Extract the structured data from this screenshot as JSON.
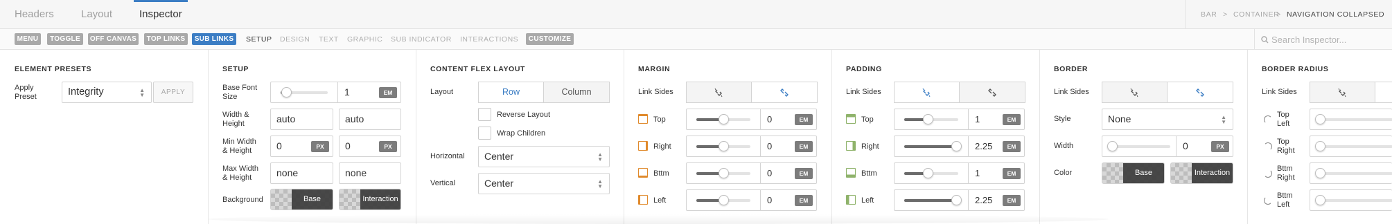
{
  "tabs": [
    "Headers",
    "Layout",
    "Inspector"
  ],
  "breadcrumb": [
    "BAR",
    ">",
    "CONTAINER",
    ">",
    "NAVIGATION COLLAPSED"
  ],
  "element_pills": [
    "MENU",
    "TOGGLE",
    "OFF CANVAS",
    "TOP LINKS",
    "SUB LINKS",
    "CUSTOMIZE"
  ],
  "sub_tabs": [
    "SETUP",
    "DESIGN",
    "TEXT",
    "GRAPHIC",
    "SUB INDICATOR",
    "INTERACTIONS"
  ],
  "search": {
    "placeholder": "Search Inspector..."
  },
  "element_presets": {
    "title": "ELEMENT PRESETS",
    "apply_label": "Apply\nPreset",
    "preset_value": "Integrity",
    "apply_button": "APPLY"
  },
  "setup": {
    "title": "SETUP",
    "base_font_label": "Base Font\nSize",
    "base_font_value": "1",
    "base_font_unit": "EM",
    "base_font_slider": 0.12,
    "wh_label": "Width &\nHeight",
    "width": "auto",
    "height": "auto",
    "min_label": "Min Width\n& Height",
    "min_width": "0",
    "min_width_unit": "PX",
    "min_height": "0",
    "min_height_unit": "PX",
    "max_label": "Max Width\n& Height",
    "max_width": "none",
    "max_height": "none",
    "background_label": "Background",
    "base_swatch": "Base",
    "interaction_swatch": "Interaction"
  },
  "flex": {
    "title": "CONTENT FLEX LAYOUT",
    "layout_label": "Layout",
    "row": "Row",
    "column": "Column",
    "reverse": "Reverse Layout",
    "wrap": "Wrap Children",
    "horizontal_label": "Horizontal",
    "horizontal_value": "Center",
    "vertical_label": "Vertical",
    "vertical_value": "Center"
  },
  "margin": {
    "title": "MARGIN",
    "link_label": "Link Sides",
    "sides": [
      {
        "label": "Top",
        "value": "0",
        "unit": "EM",
        "slider": 0.5
      },
      {
        "label": "Right",
        "value": "0",
        "unit": "EM",
        "slider": 0.5
      },
      {
        "label": "Bttm",
        "value": "0",
        "unit": "EM",
        "slider": 0.5
      },
      {
        "label": "Left",
        "value": "0",
        "unit": "EM",
        "slider": 0.5
      }
    ]
  },
  "padding": {
    "title": "PADDING",
    "link_label": "Link Sides",
    "sides": [
      {
        "label": "Top",
        "value": "1",
        "unit": "EM",
        "slider": 0.43
      },
      {
        "label": "Right",
        "value": "2.25",
        "unit": "EM",
        "slider": 0.96
      },
      {
        "label": "Bttm",
        "value": "1",
        "unit": "EM",
        "slider": 0.43
      },
      {
        "label": "Left",
        "value": "2.25",
        "unit": "EM",
        "slider": 0.96
      }
    ]
  },
  "border": {
    "title": "BORDER",
    "link_label": "Link Sides",
    "style_label": "Style",
    "style_value": "None",
    "width_label": "Width",
    "width_value": "0",
    "width_unit": "PX",
    "width_slider": 0.0,
    "color_label": "Color",
    "base_swatch": "Base",
    "interaction_swatch": "Interaction"
  },
  "radius": {
    "title": "BORDER RADIUS",
    "link_label": "Link Sides",
    "corners": [
      "Top\nLeft",
      "Top\nRight",
      "Bttm\nRight",
      "Bttm\nLeft"
    ]
  },
  "colors": {
    "accent": "#3b7dc4",
    "margin_icon": "#e08a2c",
    "padding_icon": "#8fb36b",
    "unit_badge": "#7c7c7c"
  }
}
